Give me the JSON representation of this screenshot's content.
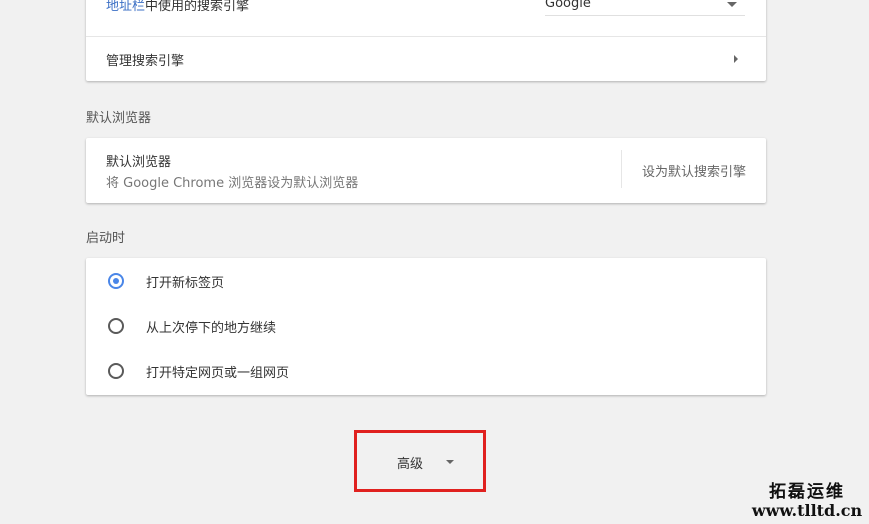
{
  "search_engine": {
    "address_bar_prefix": "地址栏",
    "address_bar_suffix": "中使用的搜索引擎",
    "selected_engine": "Google",
    "manage_label": "管理搜索引擎"
  },
  "default_browser": {
    "section_title": "默认浏览器",
    "row_title": "默认浏览器",
    "row_subtitle": "将 Google Chrome 浏览器设为默认浏览器",
    "action_label": "设为默认搜索引擎"
  },
  "startup": {
    "section_title": "启动时",
    "options": [
      {
        "label": "打开新标签页",
        "checked": true
      },
      {
        "label": "从上次停下的地方继续",
        "checked": false
      },
      {
        "label": "打开特定网页或一组网页",
        "checked": false
      }
    ]
  },
  "advanced": {
    "label": "高级"
  },
  "watermark": {
    "text_cn": "拓磊运维",
    "text_en": "www.tlltd.cn"
  },
  "colors": {
    "accent": "#4a86e8",
    "link": "#3b6fc5",
    "highlight_frame": "#e0211f"
  }
}
